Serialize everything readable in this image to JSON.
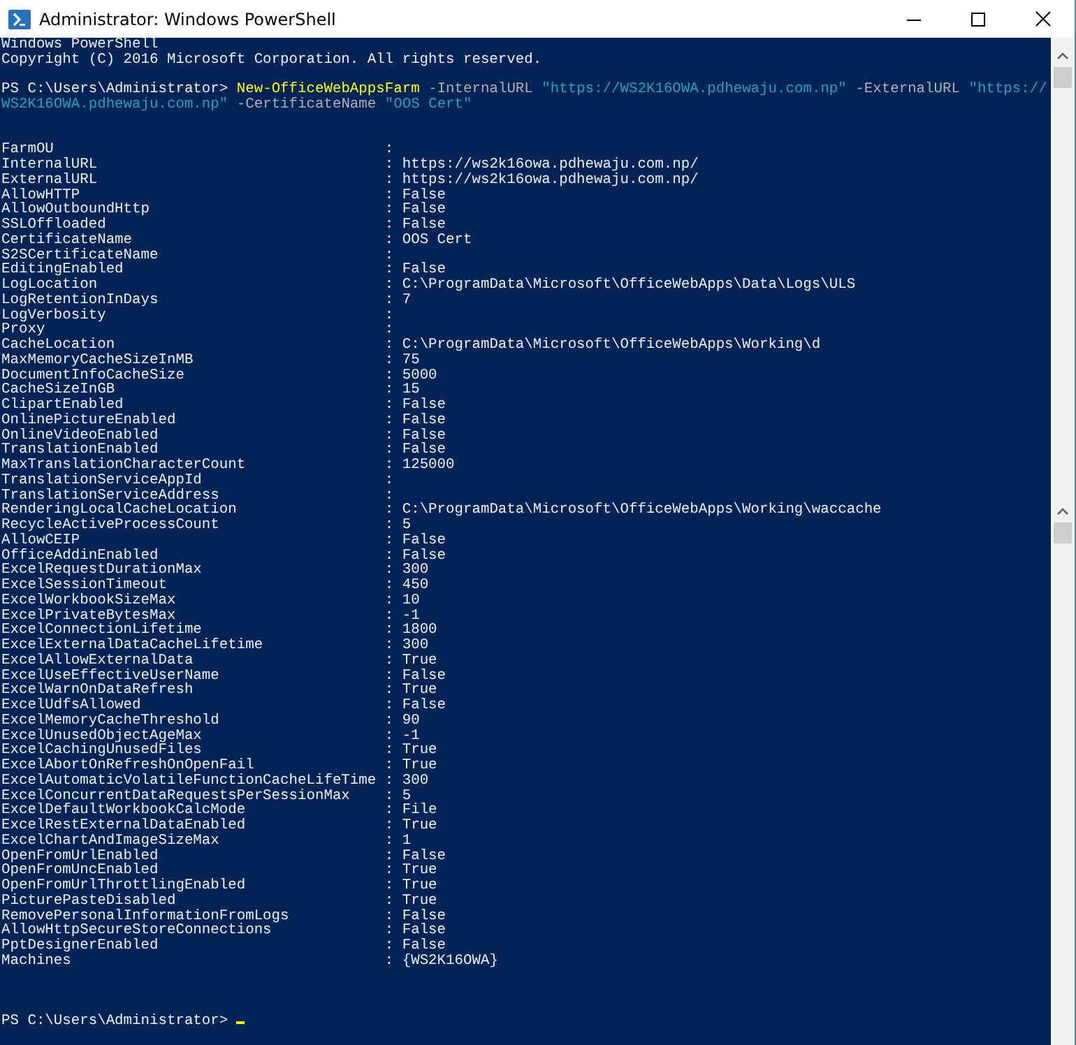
{
  "window": {
    "title": "Administrator: Windows PowerShell"
  },
  "banner": [
    "Windows PowerShell",
    "Copyright (C) 2016 Microsoft Corporation. All rights reserved."
  ],
  "command_lines": [
    [
      {
        "kind": "prompt",
        "text": "PS C:\\Users\\Administrator>"
      },
      {
        "kind": "command",
        "text": "New-OfficeWebAppsFarm"
      },
      {
        "kind": "parameter",
        "text": "-InternalURL"
      },
      {
        "kind": "string",
        "text": "\"https://WS2K16OWA.pdhewaju.com.np\""
      },
      {
        "kind": "parameter",
        "text": "-ExternalURL"
      },
      {
        "kind": "string",
        "text": "\"https://"
      }
    ],
    [
      {
        "kind": "string",
        "text": "WS2K16OWA.pdhewaju.com.np\""
      },
      {
        "kind": "parameter",
        "text": "-CertificateName"
      },
      {
        "kind": "string",
        "text": "\"OOS Cert\""
      }
    ]
  ],
  "separator": ":",
  "properties": [
    {
      "name": "FarmOU"
    },
    {
      "name": "InternalURL",
      "value": "https://ws2k16owa.pdhewaju.com.np/"
    },
    {
      "name": "ExternalURL",
      "value": "https://ws2k16owa.pdhewaju.com.np/"
    },
    {
      "name": "AllowHTTP",
      "value": "False"
    },
    {
      "name": "AllowOutboundHttp",
      "value": "False"
    },
    {
      "name": "SSLOffloaded",
      "value": "False"
    },
    {
      "name": "CertificateName",
      "value": "OOS Cert"
    },
    {
      "name": "S2SCertificateName"
    },
    {
      "name": "EditingEnabled",
      "value": "False"
    },
    {
      "name": "LogLocation",
      "value": "C:\\ProgramData\\Microsoft\\OfficeWebApps\\Data\\Logs\\ULS"
    },
    {
      "name": "LogRetentionInDays",
      "value": "7"
    },
    {
      "name": "LogVerbosity"
    },
    {
      "name": "Proxy"
    },
    {
      "name": "CacheLocation",
      "value": "C:\\ProgramData\\Microsoft\\OfficeWebApps\\Working\\d"
    },
    {
      "name": "MaxMemoryCacheSizeInMB",
      "value": "75"
    },
    {
      "name": "DocumentInfoCacheSize",
      "value": "5000"
    },
    {
      "name": "CacheSizeInGB",
      "value": "15"
    },
    {
      "name": "ClipartEnabled",
      "value": "False"
    },
    {
      "name": "OnlinePictureEnabled",
      "value": "False"
    },
    {
      "name": "OnlineVideoEnabled",
      "value": "False"
    },
    {
      "name": "TranslationEnabled",
      "value": "False"
    },
    {
      "name": "MaxTranslationCharacterCount",
      "value": "125000"
    },
    {
      "name": "TranslationServiceAppId"
    },
    {
      "name": "TranslationServiceAddress"
    },
    {
      "name": "RenderingLocalCacheLocation",
      "value": "C:\\ProgramData\\Microsoft\\OfficeWebApps\\Working\\waccache"
    },
    {
      "name": "RecycleActiveProcessCount",
      "value": "5"
    },
    {
      "name": "AllowCEIP",
      "value": "False"
    },
    {
      "name": "OfficeAddinEnabled",
      "value": "False"
    },
    {
      "name": "ExcelRequestDurationMax",
      "value": "300"
    },
    {
      "name": "ExcelSessionTimeout",
      "value": "450"
    },
    {
      "name": "ExcelWorkbookSizeMax",
      "value": "10"
    },
    {
      "name": "ExcelPrivateBytesMax",
      "value": "-1"
    },
    {
      "name": "ExcelConnectionLifetime",
      "value": "1800"
    },
    {
      "name": "ExcelExternalDataCacheLifetime",
      "value": "300"
    },
    {
      "name": "ExcelAllowExternalData",
      "value": "True"
    },
    {
      "name": "ExcelUseEffectiveUserName",
      "value": "False"
    },
    {
      "name": "ExcelWarnOnDataRefresh",
      "value": "True"
    },
    {
      "name": "ExcelUdfsAllowed",
      "value": "False"
    },
    {
      "name": "ExcelMemoryCacheThreshold",
      "value": "90"
    },
    {
      "name": "ExcelUnusedObjectAgeMax",
      "value": "-1"
    },
    {
      "name": "ExcelCachingUnusedFiles",
      "value": "True"
    },
    {
      "name": "ExcelAbortOnRefreshOnOpenFail",
      "value": "True"
    },
    {
      "name": "ExcelAutomaticVolatileFunctionCacheLifeTime",
      "value": "300"
    },
    {
      "name": "ExcelConcurrentDataRequestsPerSessionMax",
      "value": "5"
    },
    {
      "name": "ExcelDefaultWorkbookCalcMode",
      "value": "File"
    },
    {
      "name": "ExcelRestExternalDataEnabled",
      "value": "True"
    },
    {
      "name": "ExcelChartAndImageSizeMax",
      "value": "1"
    },
    {
      "name": "OpenFromUrlEnabled",
      "value": "False"
    },
    {
      "name": "OpenFromUncEnabled",
      "value": "True"
    },
    {
      "name": "OpenFromUrlThrottlingEnabled",
      "value": "True"
    },
    {
      "name": "PicturePasteDisabled",
      "value": "True"
    },
    {
      "name": "RemovePersonalInformationFromLogs",
      "value": "False"
    },
    {
      "name": "AllowHttpSecureStoreConnections",
      "value": "False"
    },
    {
      "name": "PptDesignerEnabled",
      "value": "False"
    },
    {
      "name": "Machines",
      "value": "{WS2K16OWA}"
    }
  ],
  "final_prompt": "PS C:\\Users\\Administrator>"
}
